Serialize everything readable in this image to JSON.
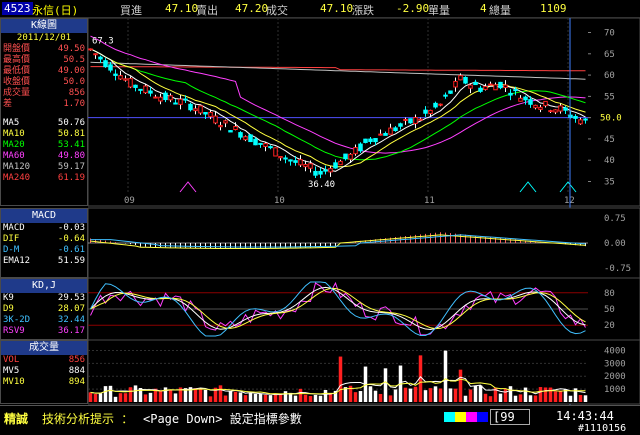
{
  "header": {
    "stock_id": "4523",
    "stock_name": "永信(日)",
    "bid_label": "買進",
    "bid": "47.10",
    "ask_label": "賣出",
    "ask": "47.20",
    "deal_label": "成交",
    "deal": "47.10",
    "change_label": "漲跌",
    "change": "-2.90",
    "volume_label": "單量",
    "volume": "4",
    "total_label": "總量",
    "total": "1109"
  },
  "kline_panel": {
    "title": "K線圖",
    "date": "2011/12/01",
    "rows": [
      {
        "label": "開盤價",
        "value": "49.50",
        "color": "#ff5050"
      },
      {
        "label": "最高價",
        "value": "50.5",
        "color": "#ff5050"
      },
      {
        "label": "最低價",
        "value": "49.00",
        "color": "#ff5050"
      },
      {
        "label": "收盤價",
        "value": "50.0",
        "color": "#ff5050"
      },
      {
        "label": "成交量",
        "value": "856",
        "color": "#ff5050"
      },
      {
        "label": "差",
        "value": "1.70",
        "color": "#ff5050"
      }
    ],
    "ma_rows": [
      {
        "label": "MA5",
        "value": "50.76",
        "color": "#ffffff"
      },
      {
        "label": "MA10",
        "value": "50.81",
        "color": "#ffff40"
      },
      {
        "label": "MA20",
        "value": "53.41",
        "color": "#00ff00"
      },
      {
        "label": "MA60",
        "value": "49.80",
        "color": "#ff40ff"
      },
      {
        "label": "MA120",
        "value": "59.17",
        "color": "#c0c0c0"
      },
      {
        "label": "MA240",
        "value": "61.19",
        "color": "#ff4040"
      }
    ]
  },
  "macd_panel": {
    "title": "MACD",
    "rows": [
      {
        "label": "MACD",
        "value": "-0.03",
        "color": "#ffffff"
      },
      {
        "label": "DIF",
        "value": "-0.64",
        "color": "#ffff40"
      },
      {
        "label": "D-M",
        "value": "-0.61",
        "color": "#40c0ff"
      },
      {
        "label": "EMA12",
        "value": "51.59",
        "color": "#ffffff"
      }
    ]
  },
  "kdj_panel": {
    "title": "KD,J",
    "rows": [
      {
        "label": "K9",
        "value": "29.53",
        "color": "#ffffff"
      },
      {
        "label": "D9",
        "value": "28.07",
        "color": "#ffff40"
      },
      {
        "label": "3K-2D",
        "value": "32.44",
        "color": "#40c0ff"
      },
      {
        "label": "RSV9",
        "value": "36.17",
        "color": "#ff40ff"
      }
    ]
  },
  "vol_panel": {
    "title": "成交量",
    "rows": [
      {
        "label": "VOL",
        "value": "856",
        "color": "#ff4040"
      },
      {
        "label": "MV5",
        "value": "884",
        "color": "#ffffff"
      },
      {
        "label": "MV10",
        "value": "894",
        "color": "#ffff40"
      }
    ]
  },
  "axes": {
    "price_ticks": [
      "70",
      "65",
      "60",
      "55",
      "50",
      "45",
      "40",
      "35"
    ],
    "current_price_label": "50.0",
    "month_labels": [
      "09",
      "10",
      "11",
      "12"
    ],
    "high_label": "67.3",
    "low_label": "36.40",
    "macd_ticks": [
      "0.75",
      "0.00",
      "-0.75"
    ],
    "kd_ticks": [
      "80",
      "50",
      "20"
    ],
    "vol_ticks": [
      "4000",
      "3000",
      "2000",
      "1000"
    ]
  },
  "bottom": {
    "brand": "精誠",
    "hint_label": "技術分析提示 ：",
    "hint_text": "<Page Down> 設定指標參數",
    "input_value": "99",
    "clock": "14:43:44",
    "id": "#1110156"
  },
  "colors": {
    "up": "#ff2020",
    "down": "#00ffff",
    "grid": "#8b0000",
    "axis": "#808080"
  }
}
